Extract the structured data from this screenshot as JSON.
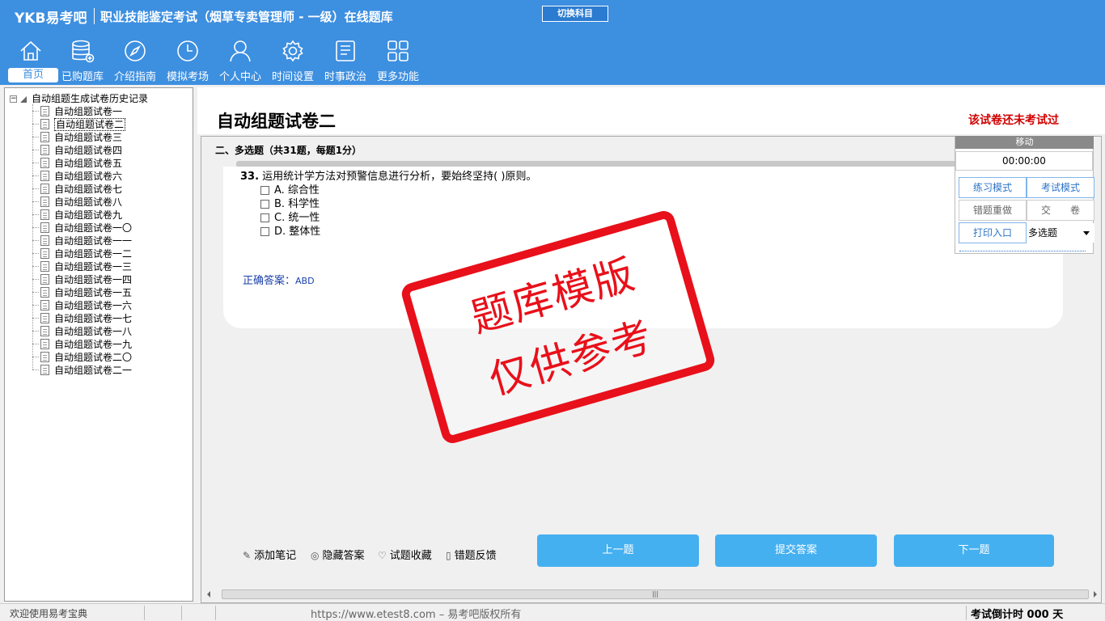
{
  "header": {
    "logo": "YKB易考吧",
    "title": "职业技能鉴定考试（烟草专卖管理师 - 一级）在线题库",
    "switch_label": "切换科目"
  },
  "nav": [
    {
      "label": "首页",
      "icon": "home-icon"
    },
    {
      "label": "已购题库",
      "icon": "database-icon"
    },
    {
      "label": "介绍指南",
      "icon": "compass-icon"
    },
    {
      "label": "模拟考场",
      "icon": "clock-icon"
    },
    {
      "label": "个人中心",
      "icon": "user-icon"
    },
    {
      "label": "时间设置",
      "icon": "gear-icon"
    },
    {
      "label": "时事政治",
      "icon": "document-icon"
    },
    {
      "label": "更多功能",
      "icon": "grid-icon"
    }
  ],
  "tree": {
    "root": "自动组题生成试卷历史记录",
    "items": [
      "自动组题试卷一",
      "自动组题试卷二",
      "自动组题试卷三",
      "自动组题试卷四",
      "自动组题试卷五",
      "自动组题试卷六",
      "自动组题试卷七",
      "自动组题试卷八",
      "自动组题试卷九",
      "自动组题试卷一〇",
      "自动组题试卷一一",
      "自动组题试卷一二",
      "自动组题试卷一三",
      "自动组题试卷一四",
      "自动组题试卷一五",
      "自动组题试卷一六",
      "自动组题试卷一七",
      "自动组题试卷一八",
      "自动组题试卷一九",
      "自动组题试卷二〇",
      "自动组题试卷二一"
    ],
    "selected_index": 1
  },
  "paper": {
    "title": "自动组题试卷二",
    "status": "该试卷还未考试过",
    "section": "二、多选题（共31题，每题1分）"
  },
  "question": {
    "number": "33.",
    "text": "运用统计学方法对预警信息进行分析，要始终坚持(  )原则。",
    "options": [
      "A. 综合性",
      "B. 科学性",
      "C. 统一性",
      "D. 整体性"
    ],
    "answer_label": "正确答案：",
    "answer_value": "ABD"
  },
  "stamp": {
    "line1": "题库模版",
    "line2": "仅供参考"
  },
  "side": {
    "move": "移动",
    "timer": "00:00:00",
    "practice_mode": "练习模式",
    "exam_mode": "考试模式",
    "redo_wrong": "错题重做",
    "submit_paper": "交　　卷",
    "print_entry": "打印入口",
    "question_type": "多选题"
  },
  "tools": {
    "add_note": "添加笔记",
    "hide_answer": "隐藏答案",
    "favorite": "试题收藏",
    "feedback": "错题反馈"
  },
  "buttons": {
    "prev": "上一题",
    "submit": "提交答案",
    "next": "下一题"
  },
  "status_bar": {
    "welcome": "欢迎使用易考宝典",
    "copyright": "https://www.etest8.com – 易考吧版权所有",
    "countdown": "考试倒计时 000 天"
  },
  "colors": {
    "header": "#3d8fe0",
    "button": "#45b0f0",
    "stamp": "#e8101a",
    "status_red": "#d00000"
  }
}
